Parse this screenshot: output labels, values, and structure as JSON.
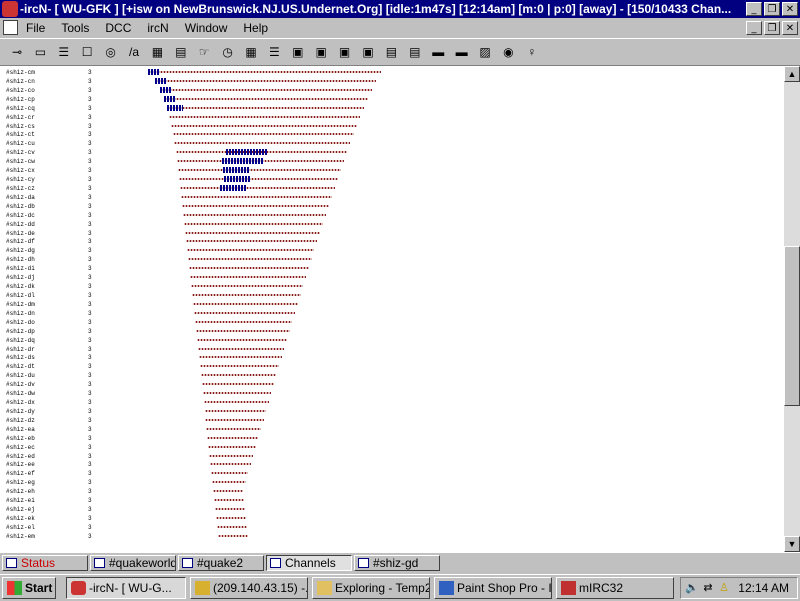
{
  "window": {
    "title": "-ircN- [ WU-GFK ] [+isw on NewBrunswick.NJ.US.Undernet.Org] [idle:1m47s] [12:14am] [m:0 | p:0] [away] - [150/10433 Chan...",
    "minimize_glyph": "_",
    "restore_glyph": "❐",
    "close_glyph": "✕"
  },
  "menu": {
    "items": [
      "File",
      "Tools",
      "DCC",
      "ircN",
      "Window",
      "Help"
    ]
  },
  "toolbar": {
    "icons": [
      "connect-icon",
      "folder-icon",
      "options-icon",
      "address-book-icon",
      "globe-icon",
      "colors-icon",
      "notify-list-icon",
      "control-icon",
      "send-icon",
      "timer-icon",
      "list-channels-icon",
      "script-editor-icon",
      "channel-list-icon",
      "dcc-chat-icon",
      "dcc-send-icon",
      "dcc-options-icon",
      "address-list-icon",
      "url-catcher-icon",
      "tile-horizontal-icon",
      "tile-vertical-icon",
      "cascade-icon",
      "help-icon",
      "away-icon"
    ],
    "glyphs": [
      "⊸",
      "▭",
      "☰",
      "☐",
      "◎",
      "/a",
      "▦",
      "▤",
      "☞",
      "◷",
      "▦",
      "☰",
      "▣",
      "▣",
      "▣",
      "▣",
      "▤",
      "▤",
      "▬",
      "▬",
      "▨",
      "◉",
      "♀"
    ]
  },
  "channel_list": {
    "rows": [
      {
        "name": "#shiz-cm",
        "count": "3"
      },
      {
        "name": "#shiz-cn",
        "count": "3"
      },
      {
        "name": "#shiz-co",
        "count": "3"
      },
      {
        "name": "#shiz-cp",
        "count": "3"
      },
      {
        "name": "#shiz-cq",
        "count": "3"
      },
      {
        "name": "#shiz-cr",
        "count": "3"
      },
      {
        "name": "#shiz-cs",
        "count": "3"
      },
      {
        "name": "#shiz-ct",
        "count": "3"
      },
      {
        "name": "#shiz-cu",
        "count": "3"
      },
      {
        "name": "#shiz-cv",
        "count": "3"
      },
      {
        "name": "#shiz-cw",
        "count": "3"
      },
      {
        "name": "#shiz-cx",
        "count": "3"
      },
      {
        "name": "#shiz-cy",
        "count": "3"
      },
      {
        "name": "#shiz-cz",
        "count": "3"
      },
      {
        "name": "#shiz-da",
        "count": "3"
      },
      {
        "name": "#shiz-db",
        "count": "3"
      },
      {
        "name": "#shiz-dc",
        "count": "3"
      },
      {
        "name": "#shiz-dd",
        "count": "3"
      },
      {
        "name": "#shiz-de",
        "count": "3"
      },
      {
        "name": "#shiz-df",
        "count": "3"
      },
      {
        "name": "#shiz-dg",
        "count": "3"
      },
      {
        "name": "#shiz-dh",
        "count": "3"
      },
      {
        "name": "#shiz-di",
        "count": "3"
      },
      {
        "name": "#shiz-dj",
        "count": "3"
      },
      {
        "name": "#shiz-dk",
        "count": "3"
      },
      {
        "name": "#shiz-dl",
        "count": "3"
      },
      {
        "name": "#shiz-dm",
        "count": "3"
      },
      {
        "name": "#shiz-dn",
        "count": "3"
      },
      {
        "name": "#shiz-do",
        "count": "3"
      },
      {
        "name": "#shiz-dp",
        "count": "3"
      },
      {
        "name": "#shiz-dq",
        "count": "3"
      },
      {
        "name": "#shiz-dr",
        "count": "3"
      },
      {
        "name": "#shiz-ds",
        "count": "3"
      },
      {
        "name": "#shiz-dt",
        "count": "3"
      },
      {
        "name": "#shiz-du",
        "count": "3"
      },
      {
        "name": "#shiz-dv",
        "count": "3"
      },
      {
        "name": "#shiz-dw",
        "count": "3"
      },
      {
        "name": "#shiz-dx",
        "count": "3"
      },
      {
        "name": "#shiz-dy",
        "count": "3"
      },
      {
        "name": "#shiz-dz",
        "count": "3"
      },
      {
        "name": "#shiz-ea",
        "count": "3"
      },
      {
        "name": "#shiz-eb",
        "count": "3"
      },
      {
        "name": "#shiz-ec",
        "count": "3"
      },
      {
        "name": "#shiz-ed",
        "count": "3"
      },
      {
        "name": "#shiz-ee",
        "count": "3"
      },
      {
        "name": "#shiz-ef",
        "count": "3"
      },
      {
        "name": "#shiz-eg",
        "count": "3"
      },
      {
        "name": "#shiz-eh",
        "count": "3"
      },
      {
        "name": "#shiz-ei",
        "count": "3"
      },
      {
        "name": "#shiz-ej",
        "count": "3"
      },
      {
        "name": "#shiz-ek",
        "count": "3"
      },
      {
        "name": "#shiz-el",
        "count": "3"
      },
      {
        "name": "#shiz-em",
        "count": "3"
      }
    ]
  },
  "switchbar": {
    "buttons": [
      {
        "label": "Status",
        "color": "#cc0000",
        "active": false
      },
      {
        "label": "#quakeworld",
        "color": "#000000",
        "active": false
      },
      {
        "label": "#quake2",
        "color": "#000000",
        "active": false
      },
      {
        "label": "Channels",
        "color": "#000000",
        "active": true
      },
      {
        "label": "#shiz-gd",
        "color": "#000000",
        "active": false
      }
    ]
  },
  "taskbar": {
    "start_label": "Start",
    "tasks": [
      {
        "label": "-ircN- [ WU-G...",
        "pressed": true
      },
      {
        "label": "(209.140.43.15) -...",
        "pressed": false
      },
      {
        "label": "Exploring - Temp2",
        "pressed": false
      },
      {
        "label": "Paint Shop Pro - I...",
        "pressed": false
      },
      {
        "label": "mIRC32",
        "pressed": false
      }
    ],
    "clock": "12:14 AM"
  },
  "colors": {
    "titlebar": "#000080",
    "dot_red": "#8b1c1c",
    "dot_blue": "#00008b"
  }
}
